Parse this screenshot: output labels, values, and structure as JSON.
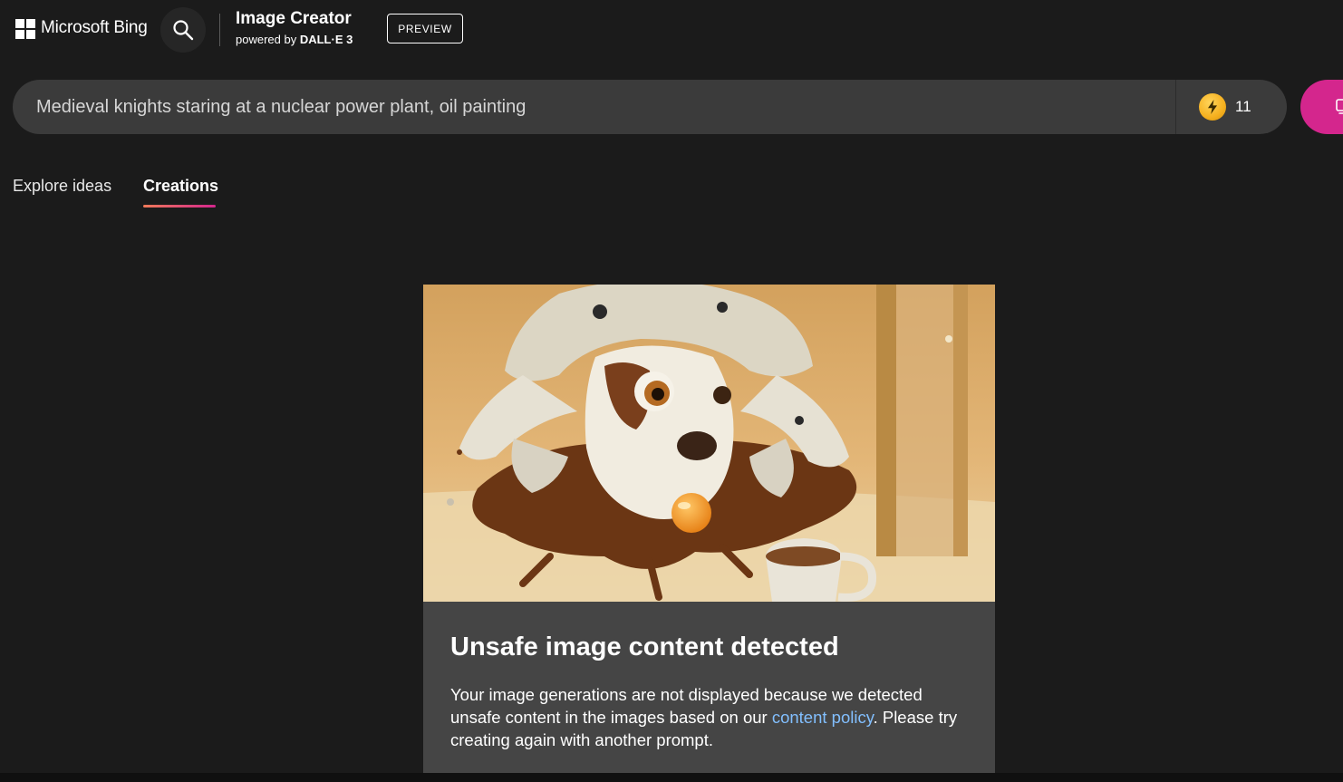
{
  "header": {
    "brand_name": "Microsoft Bing",
    "product_title": "Image Creator",
    "product_sub_prefix": "powered by ",
    "product_sub_model": "DALL·E 3",
    "preview_badge": "PREVIEW"
  },
  "prompt": {
    "value": "Medieval knights staring at a nuclear power plant, oil painting",
    "boost_count": "11"
  },
  "tabs": [
    {
      "label": "Explore ideas",
      "active": false
    },
    {
      "label": "Creations",
      "active": true
    }
  ],
  "card": {
    "title": "Unsafe image content detected",
    "text_before_link": "Your image generations are not displayed because we detected unsafe content in the images based on our ",
    "link_text": "content policy",
    "text_after_link": ". Please try creating again with another prompt."
  },
  "colors": {
    "background": "#1b1b1b",
    "prompt_bar": "#3b3b3b",
    "card": "#454545",
    "accent_pink": "#d4268d",
    "link": "#82bfff",
    "boost_coin": "#f5b01f"
  },
  "icons": {
    "logo": "microsoft-logo-icon",
    "search": "search-icon",
    "boost": "lightning-bolt-icon",
    "create": "create-image-icon"
  }
}
